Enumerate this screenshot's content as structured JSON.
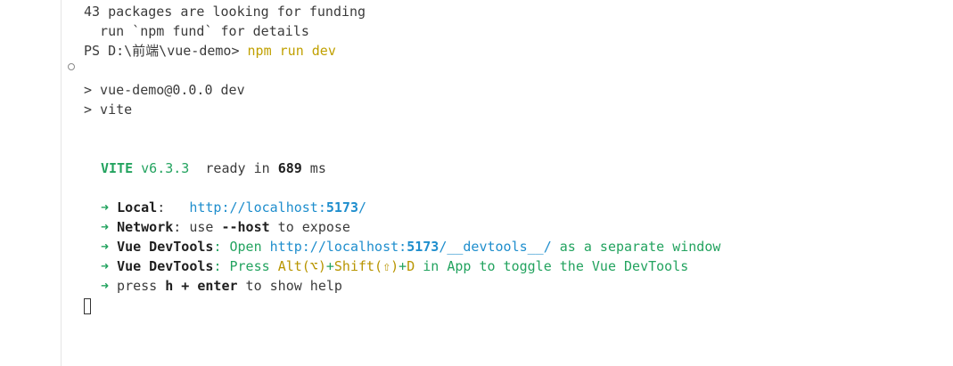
{
  "terminal": {
    "npm_output": {
      "funding_line": "43 packages are looking for funding",
      "fund_hint": "  run `npm fund` for details"
    },
    "prompt": {
      "text": "PS D:\\前端\\vue-demo> ",
      "command": "npm run dev"
    },
    "script_lines": [
      "> vue-demo@0.0.0 dev",
      "> vite"
    ],
    "vite": {
      "name": "VITE",
      "version": " v6.3.3",
      "ready_prefix": "  ready in ",
      "ready_ms": "689",
      "ready_unit": " ms"
    },
    "arrow": "➜",
    "local": {
      "label": "Local",
      "sep": ":   ",
      "url_prefix": "http://localhost:",
      "port": "5173",
      "url_suffix": "/"
    },
    "network": {
      "label": "Network",
      "text_before": ": use ",
      "flag": "--host",
      "text_after": " to expose"
    },
    "devtools_open": {
      "label": "Vue DevTools",
      "text_before": ": Open ",
      "url_prefix": "http://localhost:",
      "port": "5173",
      "url_suffix": "/__devtools__/",
      "text_after": " as a separate window"
    },
    "devtools_toggle": {
      "label": "Vue DevTools",
      "text_before": ": Press ",
      "alt": "Alt(⌥)",
      "plus1": "+",
      "shift": "Shift(⇧)",
      "plus2": "+",
      "key": "D",
      "text_after": " in App to toggle the Vue DevTools"
    },
    "help": {
      "text_before": " press ",
      "key1": "h",
      "plus": " + ",
      "key2": "enter",
      "text_after": " to show help"
    }
  }
}
